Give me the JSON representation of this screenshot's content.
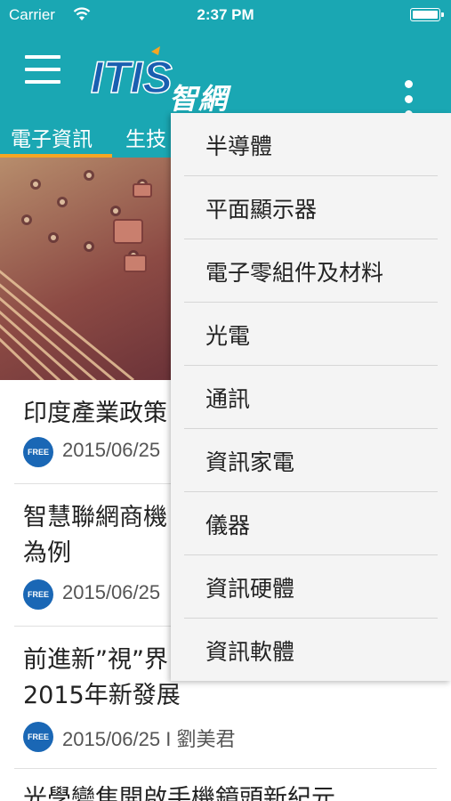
{
  "status_bar": {
    "carrier": "Carrier",
    "time": "2:37 PM"
  },
  "app_bar": {
    "logo_text": "智網"
  },
  "tabs": [
    {
      "label": "電子資訊"
    },
    {
      "label": "生技"
    }
  ],
  "articles": [
    {
      "title_lines": [
        "印度產業政策"
      ],
      "badge": "FREE",
      "date": "2015/06/25"
    },
    {
      "title_lines": [
        "智慧聯網商機",
        "為例"
      ],
      "badge": "FREE",
      "date": "2015/06/25"
    },
    {
      "title_lines": [
        "前進新”視”界",
        "2015年新發展"
      ],
      "badge": "FREE",
      "date": "2015/06/25 I 劉美君"
    },
    {
      "title_lines": [
        "光學變焦開啟手機鏡頭新紀元"
      ]
    }
  ],
  "menu": {
    "items": [
      {
        "label": "半導體"
      },
      {
        "label": "平面顯示器"
      },
      {
        "label": "電子零組件及材料"
      },
      {
        "label": "光電"
      },
      {
        "label": "通訊"
      },
      {
        "label": "資訊家電"
      },
      {
        "label": "儀器"
      },
      {
        "label": "資訊硬體"
      },
      {
        "label": "資訊軟體"
      }
    ]
  },
  "colors": {
    "primary": "#1aa7b3",
    "accent": "#f5a623",
    "badge": "#1a67b5"
  },
  "icons": [
    "wifi-icon",
    "battery-icon",
    "menu-icon",
    "more-vert-icon",
    "free-badge"
  ]
}
